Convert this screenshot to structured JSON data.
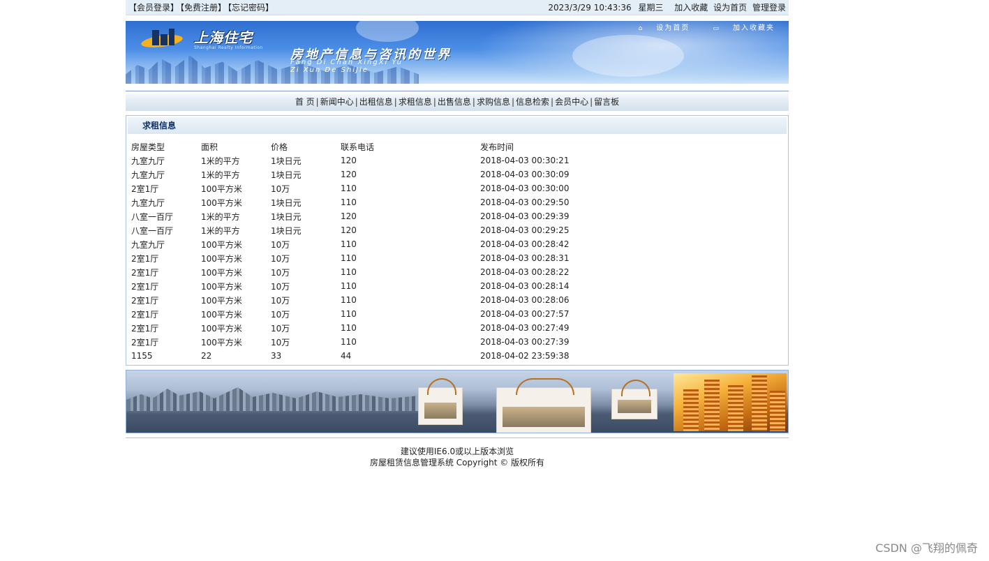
{
  "topbar": {
    "member_login": "【会员登录】",
    "register": "【免费注册】",
    "forgot_password": "【忘记密码】",
    "datetime": "2023/3/29 10:43:36",
    "weekday": "星期三",
    "add_favorite": "加入收藏",
    "set_homepage": "设为首页",
    "admin_login": "管理登录"
  },
  "banner": {
    "logo_text": "上海住宅",
    "logo_subtext": "Shanghai Realty Information",
    "slogan": "房地产信息与咨讯的世界",
    "pinyin_line1": "Fang Di Chan XingXi Yu",
    "pinyin_line2": "Zi Xun De ShiJie",
    "set_home_link": "设为首页",
    "add_fav_link": "加入收藏夹"
  },
  "nav": {
    "items": [
      "首 页",
      "新闻中心",
      "出租信息",
      "求租信息",
      "出售信息",
      "求购信息",
      "信息检索",
      "会员中心",
      "留言板"
    ]
  },
  "list": {
    "title": "求租信息",
    "columns": [
      "房屋类型",
      "面积",
      "价格",
      "联系电话",
      "发布时间"
    ],
    "rows": [
      [
        "九室九厅",
        "1米的平方",
        "1块日元",
        "120",
        "2018-04-03 00:30:21"
      ],
      [
        "九室九厅",
        "1米的平方",
        "1块日元",
        "120",
        "2018-04-03 00:30:09"
      ],
      [
        "2室1厅",
        "100平方米",
        "10万",
        "110",
        "2018-04-03 00:30:00"
      ],
      [
        "九室九厅",
        "100平方米",
        "1块日元",
        "110",
        "2018-04-03 00:29:50"
      ],
      [
        "八室一百厅",
        "1米的平方",
        "1块日元",
        "120",
        "2018-04-03 00:29:39"
      ],
      [
        "八室一百厅",
        "1米的平方",
        "1块日元",
        "120",
        "2018-04-03 00:29:25"
      ],
      [
        "九室九厅",
        "100平方米",
        "10万",
        "110",
        "2018-04-03 00:28:42"
      ],
      [
        "2室1厅",
        "100平方米",
        "10万",
        "110",
        "2018-04-03 00:28:31"
      ],
      [
        "2室1厅",
        "100平方米",
        "10万",
        "110",
        "2018-04-03 00:28:22"
      ],
      [
        "2室1厅",
        "100平方米",
        "10万",
        "110",
        "2018-04-03 00:28:14"
      ],
      [
        "2室1厅",
        "100平方米",
        "10万",
        "110",
        "2018-04-03 00:28:06"
      ],
      [
        "2室1厅",
        "100平方米",
        "10万",
        "110",
        "2018-04-03 00:27:57"
      ],
      [
        "2室1厅",
        "100平方米",
        "10万",
        "110",
        "2018-04-03 00:27:49"
      ],
      [
        "2室1厅",
        "100平方米",
        "10万",
        "110",
        "2018-04-03 00:27:39"
      ],
      [
        "1155",
        "22",
        "33",
        "44",
        "2018-04-02 23:59:38"
      ]
    ]
  },
  "footer": {
    "line1": "建议使用IE6.0或以上版本浏览",
    "line2": "房屋租赁信息管理系统 Copyright © 版权所有"
  },
  "watermark": "CSDN @飞翔的佩奇"
}
